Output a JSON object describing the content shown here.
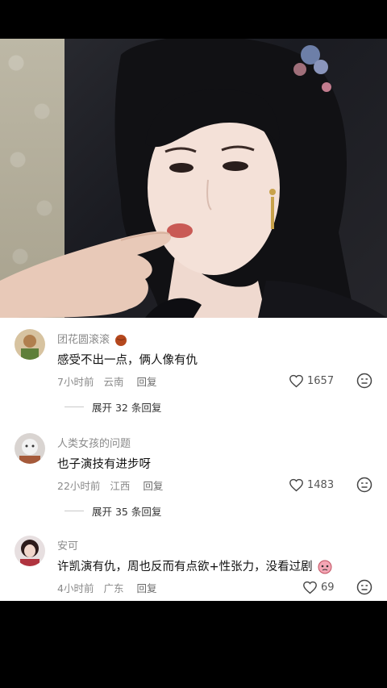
{
  "video_frame": {
    "description_icon": "photo-still"
  },
  "comments": [
    {
      "username": "团花圆滚滚",
      "username_badge": "ball-emoji",
      "text": "感受不出一点，俩人像有仇",
      "time": "7小时前",
      "location": "云南",
      "reply_label": "回复",
      "likes": "1657",
      "expand_label": "展开 32 条回复",
      "avatar_color": "#c8a070"
    },
    {
      "username": "人类女孩的问题",
      "text": "也子演技有进步呀",
      "time": "22小时前",
      "location": "江西",
      "reply_label": "回复",
      "likes": "1483",
      "expand_label": "展开 35 条回复",
      "avatar_color": "#b9b3b3"
    },
    {
      "username": "安可",
      "text": "许凯演有仇，周也反而有点欲+性张力，没看过剧",
      "text_emoji": "cry-sticker",
      "time": "4小时前",
      "location": "广东",
      "reply_label": "回复",
      "likes": "69",
      "avatar_color": "#5b3a3a"
    }
  ],
  "colors": {
    "like_icon": "#444444",
    "secondary_text": "#8a8a8a"
  }
}
